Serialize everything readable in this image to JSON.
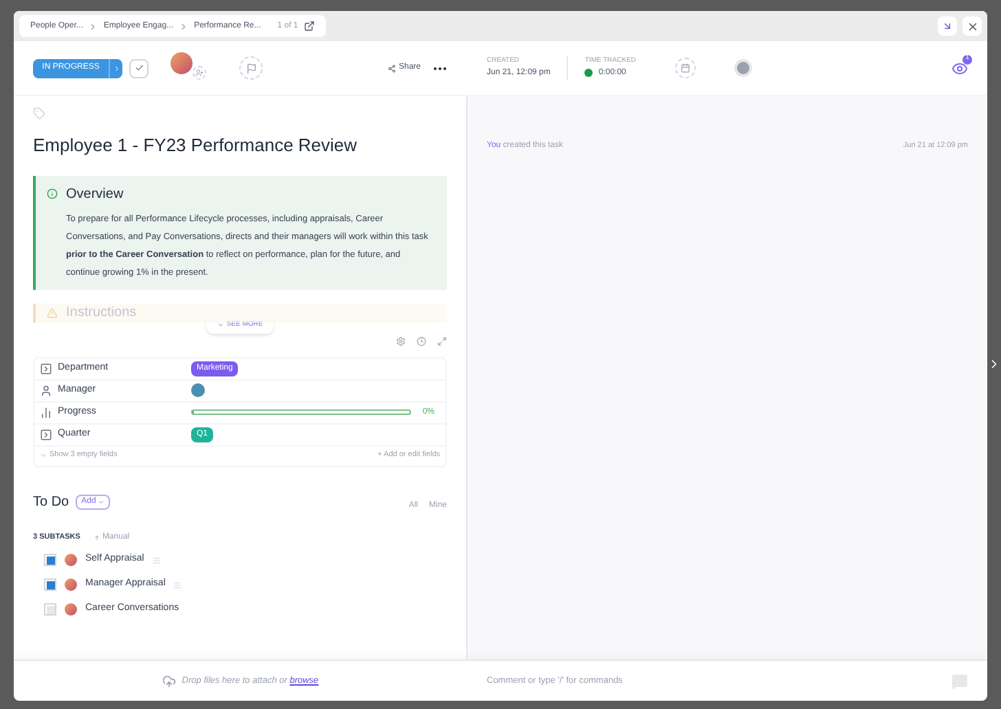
{
  "breadcrumbs": [
    "People Oper...",
    "Employee Engag...",
    "Performance Re..."
  ],
  "page_count": "1 of 1",
  "status": {
    "label": "IN PROGRESS"
  },
  "share": "Share",
  "created": {
    "label": "CREATED",
    "value": "Jun 21, 12:09 pm"
  },
  "time_tracked": {
    "label": "TIME TRACKED",
    "value": "0:00:00"
  },
  "watchers_count": "1",
  "title": "Employee 1 - FY23 Performance Review",
  "overview": {
    "heading": "Overview",
    "text": "To prepare for all Performance Lifecycle processes, including appraisals, Career Conversations, and Pay Conversations, directs and their managers will work within this task **prior to the Career Conversation** to reflect on performance, plan for the future, and continue growing 1% in the present."
  },
  "instructions_heading": "Instructions",
  "see_more": "SEE MORE",
  "fields": [
    {
      "kind": "tag",
      "label": "Department",
      "value": "Marketing",
      "color": "#7b5cf0"
    },
    {
      "kind": "person",
      "label": "Manager"
    },
    {
      "kind": "progress",
      "label": "Progress",
      "level": 0,
      "reading": "0%"
    },
    {
      "kind": "tag",
      "label": "Quarter",
      "value": "Q1",
      "color": "#1fb39a"
    }
  ],
  "show_empty": "Show 3 empty fields",
  "add_fields": "+ Add or edit fields",
  "todo": {
    "heading": "To Do",
    "add": "Add",
    "filters": [
      "All",
      "Mine"
    ]
  },
  "subtasks": {
    "count": "3 SUBTASKS",
    "sort": "Manual",
    "items": [
      {
        "name": "Self Appraisal",
        "checked": true
      },
      {
        "name": "Manager Appraisal",
        "checked": true
      },
      {
        "name": "Career Conversations",
        "checked": false
      }
    ]
  },
  "drop_text": "Drop files here to attach or",
  "browse": "browse",
  "activity": [
    {
      "actor": "You",
      "text": "created this task",
      "time": "Jun 21 at 12:09 pm"
    }
  ],
  "comment_placeholder": "Comment or type '/' for commands"
}
